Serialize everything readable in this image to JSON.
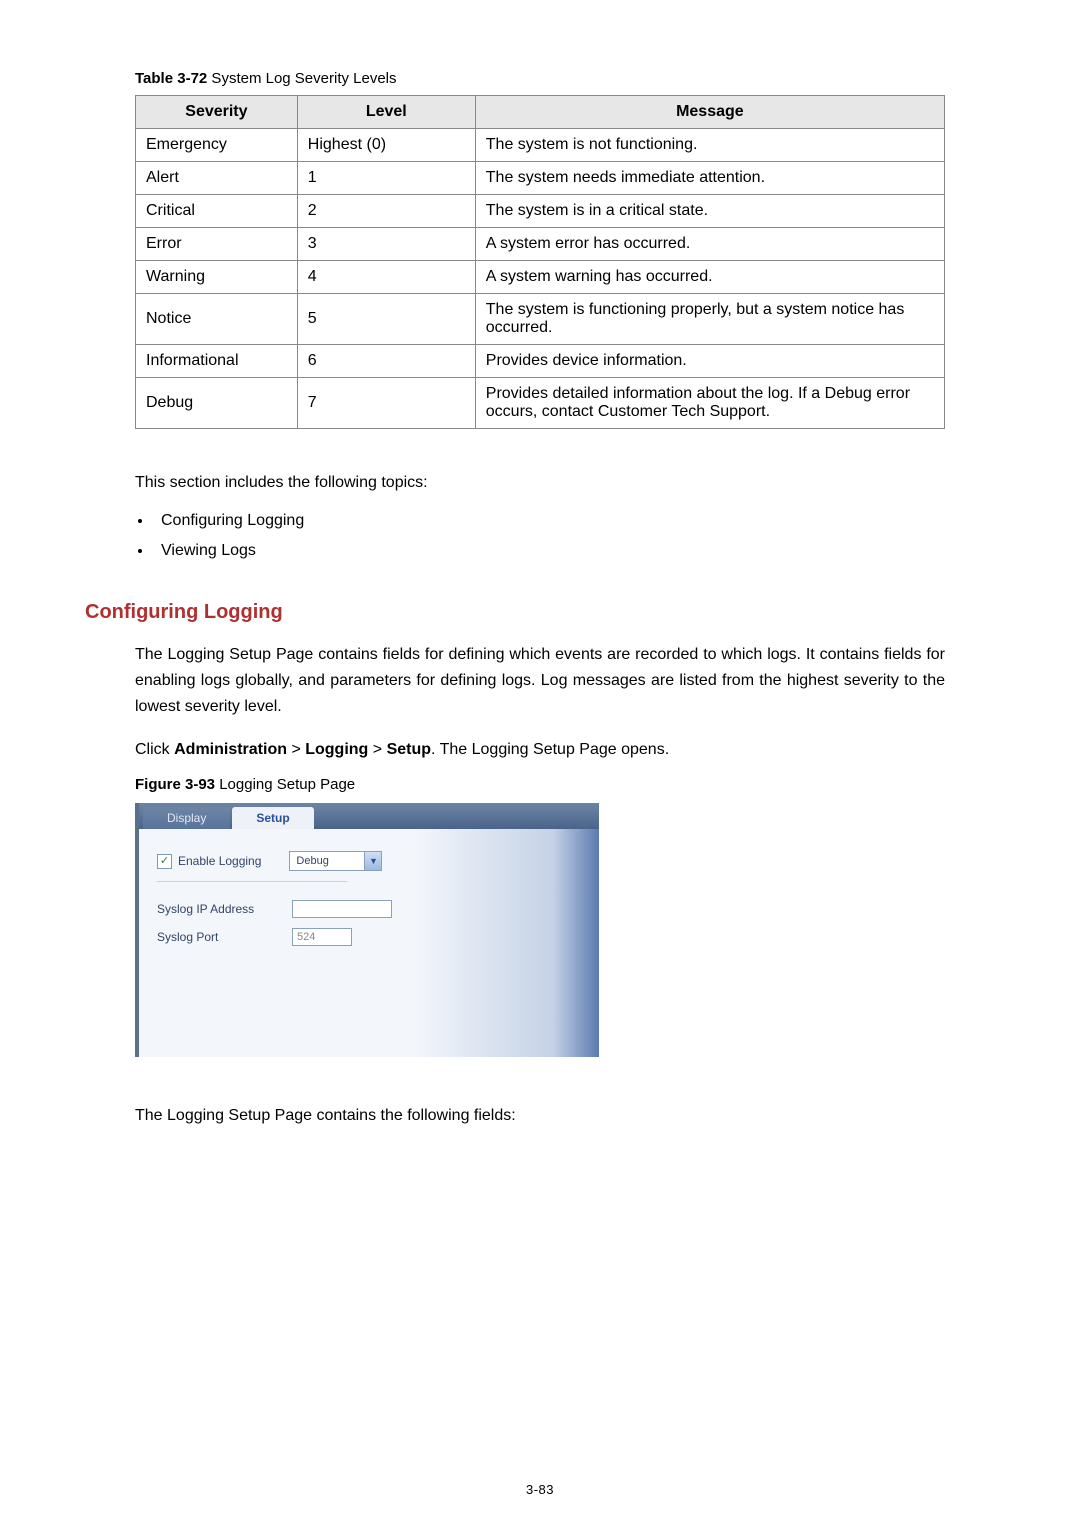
{
  "table": {
    "caption_prefix": "Table 3-72",
    "caption_rest": " System Log Severity Levels",
    "headers": {
      "c1": "Severity",
      "c2": "Level",
      "c3": "Message"
    },
    "rows": [
      {
        "severity": "Emergency",
        "level": "Highest (0)",
        "message": "The system is not functioning."
      },
      {
        "severity": "Alert",
        "level": "1",
        "message": "The system needs immediate attention."
      },
      {
        "severity": "Critical",
        "level": "2",
        "message": "The system is in a critical state."
      },
      {
        "severity": "Error",
        "level": "3",
        "message": "A system error has occurred."
      },
      {
        "severity": "Warning",
        "level": "4",
        "message": "A system warning has occurred."
      },
      {
        "severity": "Notice",
        "level": "5",
        "message": "The system is functioning properly, but a system notice has occurred."
      },
      {
        "severity": "Informational",
        "level": "6",
        "message": "Provides device information."
      },
      {
        "severity": "Debug",
        "level": "7",
        "message": "Provides detailed information about the log. If a Debug error occurs, contact Customer Tech Support."
      }
    ]
  },
  "intro": {
    "lead": "This section includes the following topics:",
    "bullets": [
      "Configuring Logging",
      "Viewing Logs"
    ]
  },
  "section": {
    "heading": "Configuring Logging",
    "para1": "The Logging Setup Page contains fields for defining which events are recorded to which logs. It contains fields for enabling logs globally, and parameters for defining logs. Log messages are listed from the highest severity to the lowest severity level.",
    "click_line": {
      "pre": "Click ",
      "b1": "Administration",
      "sep": " > ",
      "b2": "Logging",
      "b3": "Setup",
      "post": ". The Logging Setup Page opens."
    },
    "figure_caption_prefix": "Figure 3-93",
    "figure_caption_rest": " Logging Setup Page",
    "after_figure": "The Logging Setup Page contains the following fields:"
  },
  "screenshot": {
    "tabs": {
      "display": "Display",
      "setup": "Setup"
    },
    "enable_logging_label": "Enable Logging",
    "enable_logging_checked": "✓",
    "level_select_value": "Debug",
    "syslog_ip_label": "Syslog IP Address",
    "syslog_ip_value": "",
    "syslog_port_label": "Syslog Port",
    "syslog_port_value": "524"
  },
  "page_number": "3-83"
}
